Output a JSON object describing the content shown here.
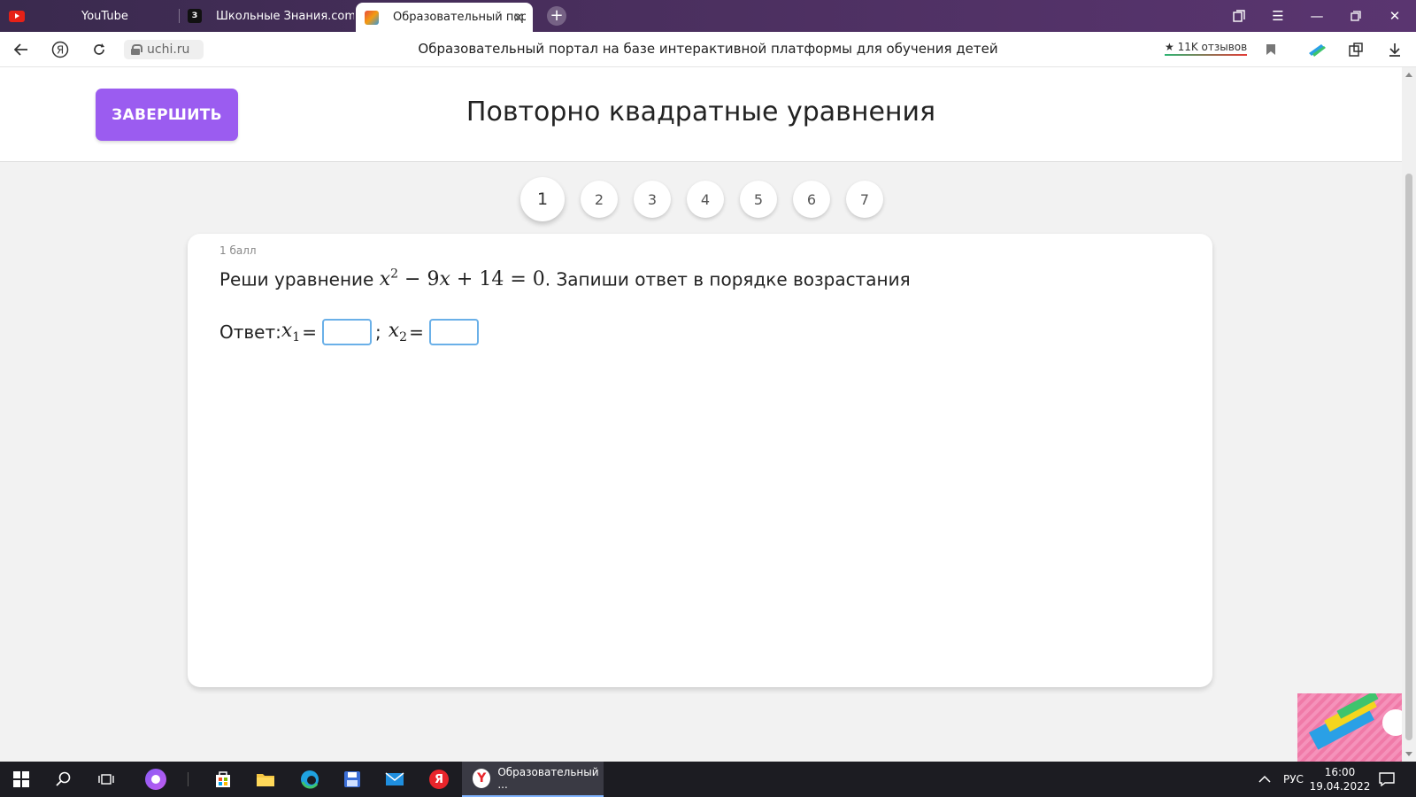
{
  "browser": {
    "tabs": [
      {
        "title": "YouTube",
        "icon": "youtube-icon"
      },
      {
        "title": "Школьные Знания.com - F",
        "icon": "znania-icon"
      },
      {
        "title": "Образовательный порта",
        "icon": "uchi-icon",
        "active": true
      }
    ],
    "new_tab": "+",
    "url": "uchi.ru",
    "page_title": "Образовательный портал на базе интерактивной платформы для обучения детей",
    "reviews": "★ 11K отзывов"
  },
  "page": {
    "finish_button": "ЗАВЕРШИТЬ",
    "title": "Повторно квадратные уравнения",
    "steps": [
      "1",
      "2",
      "3",
      "4",
      "5",
      "6",
      "7"
    ],
    "active_step": "1",
    "task": {
      "points": "1 балл",
      "prompt_before": "Реши уравнение",
      "equation": {
        "x": "x",
        "exp": "2",
        "rest": " − 9",
        "x2": "x",
        "tail": " + 14 = 0"
      },
      "prompt_after": ". Запиши ответ в порядке возрастания",
      "answer_label": "Ответ:",
      "x1_var": "x",
      "x1_sub": "1",
      "x2_var": "x",
      "x2_sub": "2",
      "equals": "=",
      "separator": ";",
      "x1_value": "",
      "x2_value": ""
    }
  },
  "taskbar": {
    "active_app": "Образовательный ...",
    "lang": "РУС",
    "time": "16:00",
    "date": "19.04.2022"
  },
  "colors": {
    "accent": "#9b5cf0",
    "input_border": "#6ab0e8"
  }
}
